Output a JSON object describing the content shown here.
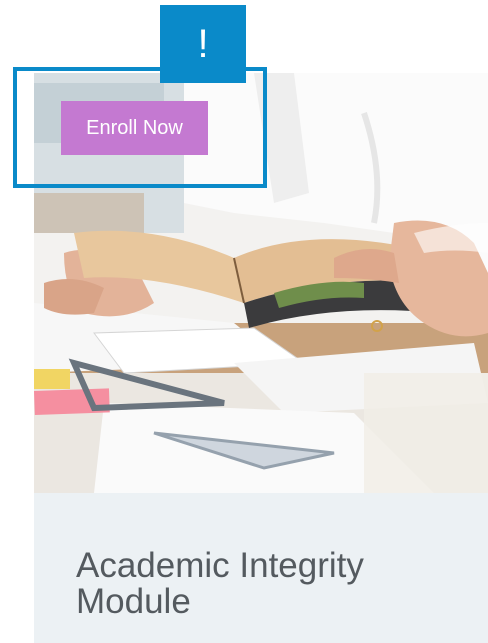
{
  "course_card": {
    "enroll_label": "Enroll Now",
    "title": "Academic Integrity Module"
  },
  "alert": {
    "symbol": "!",
    "color": "#0a8ac9"
  },
  "colors": {
    "enroll_button": "#c479d1",
    "card_background": "#ecf1f4",
    "title_text": "#545a5f"
  },
  "hero_image": {
    "icon": "student-reading-book-photo"
  }
}
